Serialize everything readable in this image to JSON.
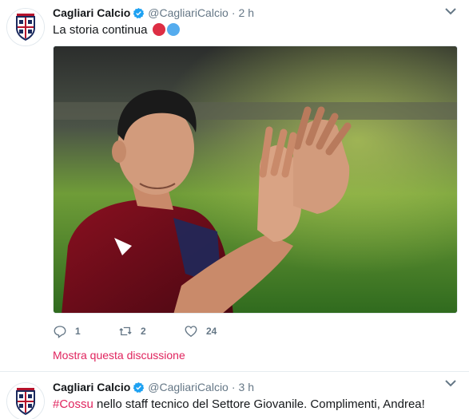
{
  "tweets": [
    {
      "name": "Cagliari Calcio",
      "handle": "@CagliariCalcio",
      "separator": "·",
      "time": "2 h",
      "text": "La storia continua",
      "emoji": [
        "red-circle",
        "blue-circle"
      ],
      "replies": "1",
      "retweets": "2",
      "likes": "24",
      "thread_link": "Mostra questa discussione"
    },
    {
      "name": "Cagliari Calcio",
      "handle": "@CagliariCalcio",
      "separator": "·",
      "time": "3 h",
      "hashtag": "#Cossu",
      "text": " nello staff tecnico del Settore Giovanile. Complimenti, Andrea!"
    }
  ],
  "colors": {
    "text": "#14171a",
    "muted": "#657786",
    "link": "#e0245e",
    "verified": "#1da1f2",
    "emoji_red": "#dd2e44",
    "emoji_blue": "#55acee",
    "club_red": "#b5122b",
    "club_navy": "#1b2a5e"
  },
  "icons": [
    "cagliari-crest-icon",
    "verified-badge-icon",
    "chevron-down-icon",
    "reply-icon",
    "retweet-icon",
    "like-icon"
  ]
}
